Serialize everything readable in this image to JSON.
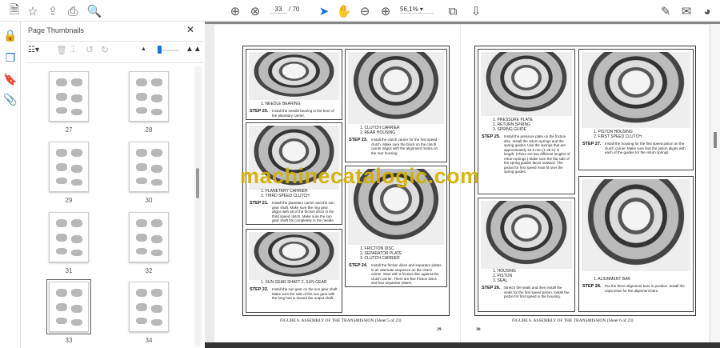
{
  "toolbar": {
    "page_current": "33",
    "page_total": "/ 70",
    "zoom": "56,1%"
  },
  "panel": {
    "title": "Page Thumbnails",
    "thumbnails": [
      "27",
      "28",
      "29",
      "30",
      "31",
      "32",
      "33",
      "34"
    ],
    "selected": "33"
  },
  "colors": {
    "accent": "#1473e6",
    "watermark": "#d2b000"
  },
  "watermark": "machinecatalogic.com",
  "left_page": {
    "panels": [
      {
        "caption": "1. NEEDLE BEARING",
        "step": "STEP 20.",
        "text": "Install the needle bearing in the bore of the planetary carrier."
      },
      {
        "caption": "1. CLUTCH CARRIER\n2. REAR HOUSING",
        "step": "STEP 23.",
        "text": "Install the clutch carrier for the first speed clutch. Make sure the block on the clutch carrier aligns with the alignment marks on the rear housing."
      },
      {
        "caption": "1. PLANETARY CARRIER\n2. THIRD SPEED CLUTCH",
        "step": "STEP 21.",
        "text": "Install the planetary carrier and the sun gear shaft. Make sure the ring gear aligns with all of the friction discs in the third speed clutch. Make sure the sun gear shaft fits completely in the needle bearing."
      },
      {
        "caption": "1. FRICTION DISC\n2. SEPARATOR PLATE\n3. CLUTCH CARRIER",
        "step": "STEP 24.",
        "text": "Install the friction discs and separator plates in an alternate sequence on the clutch carrier. Start with a friction disc against the clutch carrier. There are five friction discs and four separator plates."
      },
      {
        "caption": "1. SUN GEAR SHAFT          2. SUN GEAR",
        "step": "STEP 22.",
        "text": "Install the sun gear on the sun gear shaft. Make sure the side of the sun gear with the long hub is toward the output shaft."
      }
    ],
    "figure": "FIGURE 6. ASSEMBLY OF THE TRANSMISSION (Sheet 5 of 23)",
    "number": "29"
  },
  "right_page": {
    "panels": [
      {
        "caption": "1. PRESSURE PLATE\n2. RETURN SPRING\n3. SPRING GUIDE",
        "step": "STEP 25.",
        "text": "Install the pressure plate on the friction disc. Install the return springs and the spring guides. Use the springs that are approximately 34.5 mm (1.36 in) in length. (There are two different lengths of return springs.) Make sure the flat side of the spring guides faces outward. The piston for first speed must fit over the spring guides."
      },
      {
        "caption": "1. PISTON HOUSING\n2. FIRST SPEED CLUTCH",
        "step": "STEP 27.",
        "text": "Install the housing for the first speed piston on the clutch carrier. Make sure that the piston aligns with each of the guides for the return springs."
      },
      {
        "caption": "1. HOUSING\n2. PISTON\n3. SEAL",
        "step": "STEP 26.",
        "text": "Stretch the seals and then install the seals for the first speed piston. Install the piston for first speed in the housing."
      },
      {
        "caption": "1. ALIGNMENT BAR",
        "step": "STEP 28.",
        "text": "Put the three alignment bars in position. Install the capscrews for the alignment bars."
      }
    ],
    "figure": "FIGURE 6. ASSEMBLY OF THE TRANSMISSION (Sheet 6 of 23)",
    "number": "30"
  }
}
